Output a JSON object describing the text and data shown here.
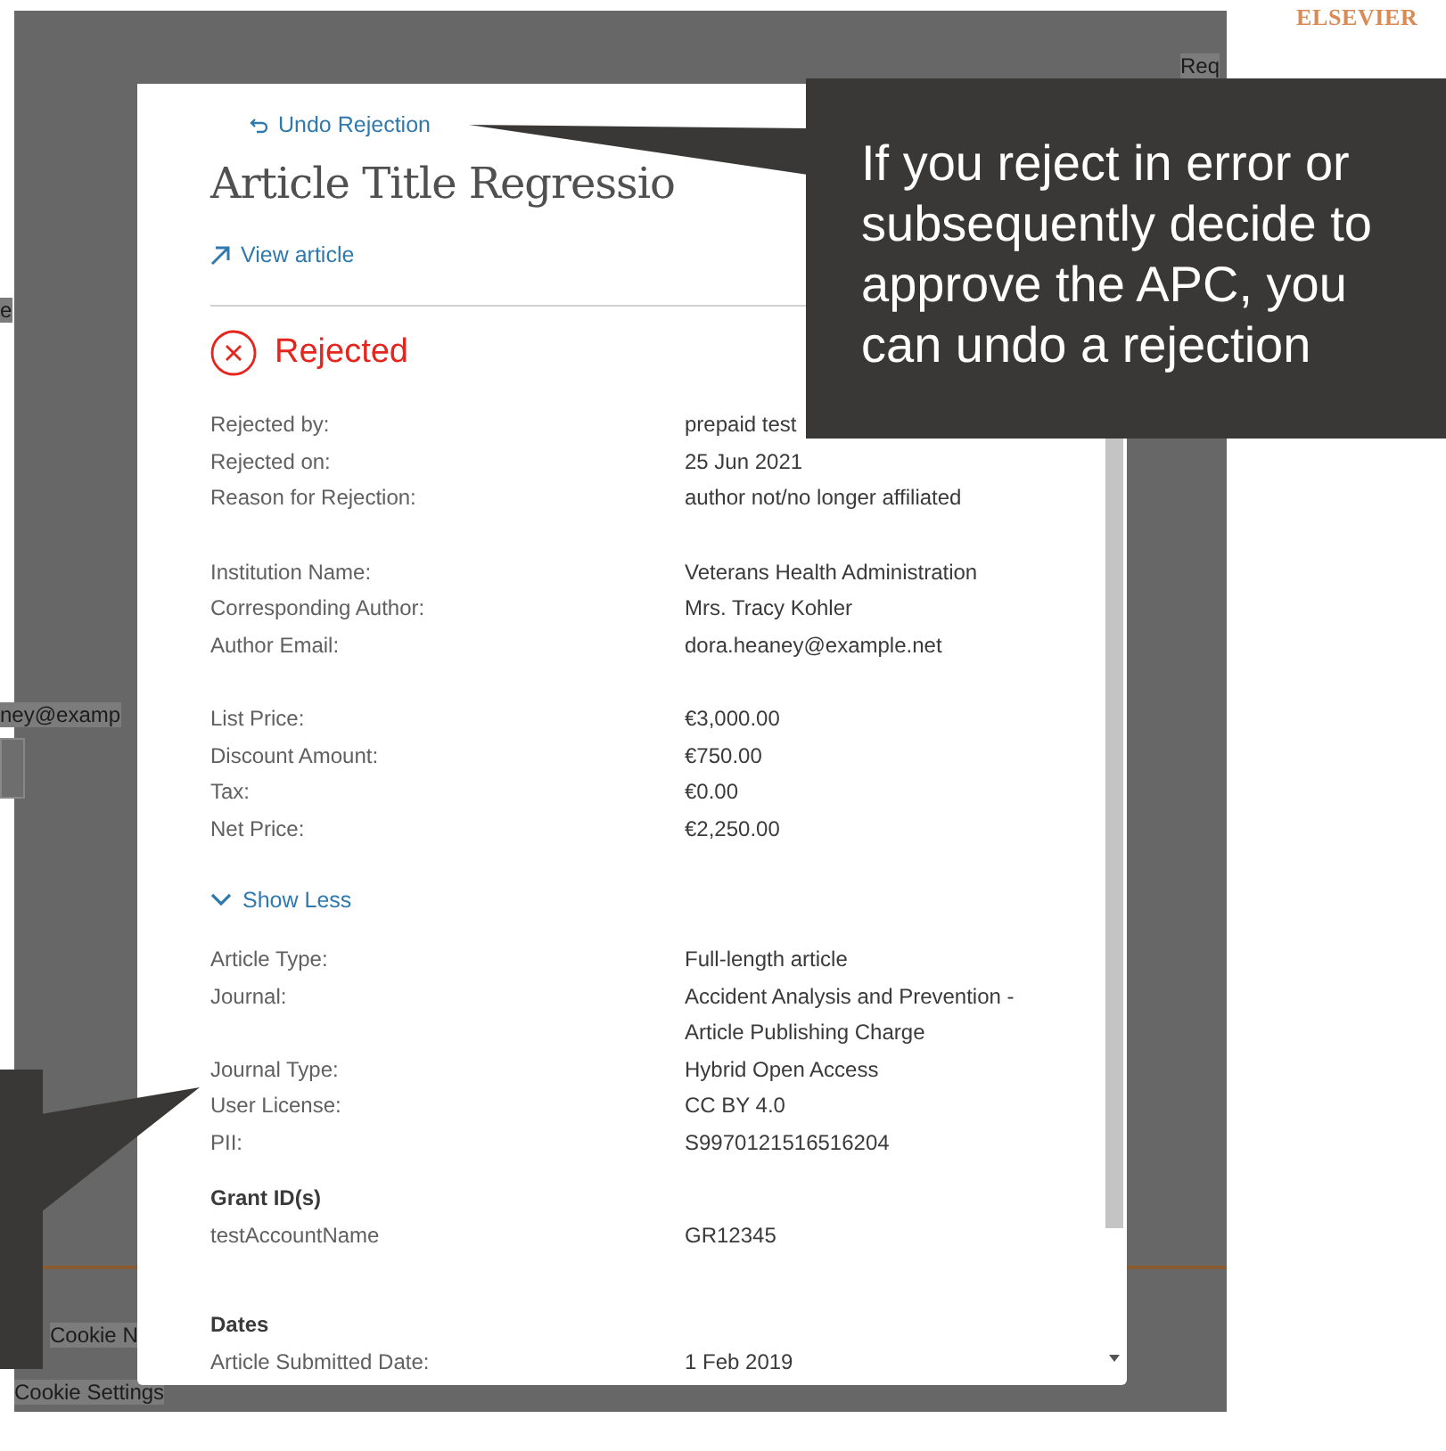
{
  "background_page": {
    "brand": "ELSEVIER",
    "fragments": [
      {
        "kind": "header",
        "text": "Req"
      },
      {
        "kind": "label",
        "text": "e"
      },
      {
        "kind": "field",
        "text": "ney@examp"
      },
      {
        "kind": "footer",
        "text": "Cookie N"
      },
      {
        "kind": "footer-link",
        "text": "Cookie Settings"
      }
    ]
  },
  "modal": {
    "undo_link": "Undo Rejection",
    "title": "Article Title Regressio",
    "view_link": "View article",
    "status": {
      "kind": "rejected",
      "label": "Rejected"
    },
    "summary_groups": [
      {
        "rows": [
          {
            "label": "Rejected by:",
            "value": "prepaid test"
          },
          {
            "label": "Rejected on:",
            "value": "25 Jun 2021"
          },
          {
            "label": "Reason for Rejection:",
            "value": "author not/no longer affiliated"
          }
        ]
      },
      {
        "rows": [
          {
            "label": "Institution Name:",
            "value": "Veterans Health Administration"
          },
          {
            "label": "Corresponding Author:",
            "value": "Mrs. Tracy Kohler"
          },
          {
            "label": "Author Email:",
            "value": "dora.heaney@example.net"
          }
        ]
      },
      {
        "rows": [
          {
            "label": "List Price:",
            "value": "€3,000.00"
          },
          {
            "label": "Discount Amount:",
            "value": "€750.00"
          },
          {
            "label": "Tax:",
            "value": "€0.00"
          },
          {
            "label": "Net Price:",
            "value": "€2,250.00"
          }
        ]
      }
    ],
    "toggle": {
      "label": "Show Less",
      "expanded": true
    },
    "detail_groups": [
      {
        "rows": [
          {
            "label": "Article Type:",
            "value": "Full-length article"
          },
          {
            "label": "Journal:",
            "value": "Accident Analysis and Prevention - Article Publishing Charge"
          },
          {
            "label": "Journal Type:",
            "value": "Hybrid Open Access"
          },
          {
            "label": "User License:",
            "value": "CC BY 4.0"
          },
          {
            "label": "PII:",
            "value": "S9970121516516204"
          }
        ]
      },
      {
        "heading": "Grant ID(s)",
        "rows": [
          {
            "label": "testAccountName",
            "value": "GR12345"
          }
        ]
      },
      {
        "heading": "Dates",
        "rows": [
          {
            "label": "Article Submitted Date:",
            "value": "1 Feb 2019"
          }
        ]
      }
    ]
  },
  "callouts": [
    {
      "kind": "right",
      "text": "If you reject in error or subsequently decide to approve the APC, you can undo a rejection"
    },
    {
      "kind": "left"
    }
  ]
}
